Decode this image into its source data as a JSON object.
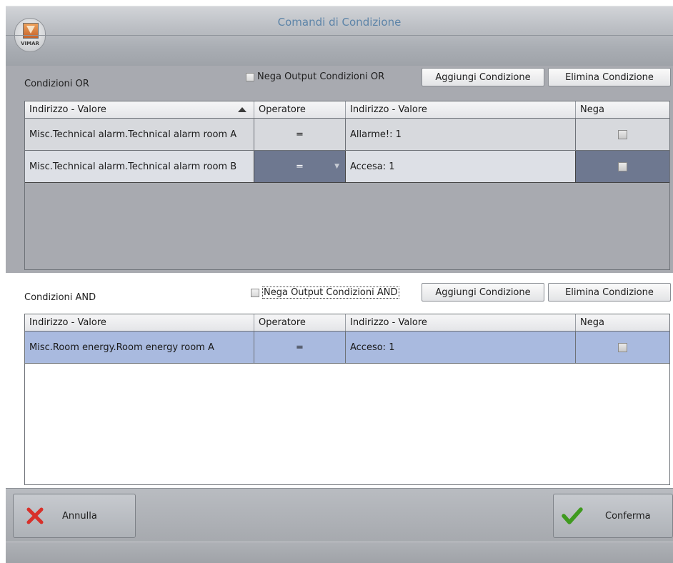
{
  "window": {
    "title": "Comandi di Condizione",
    "logo_text": "VIMAR"
  },
  "columns": {
    "address": "Indirizzo - Valore",
    "operator": "Operatore",
    "value": "Indirizzo - Valore",
    "negate": "Nega"
  },
  "or_section": {
    "label": "Condizioni OR",
    "negate_label": "Nega Output Condizioni OR",
    "add_label": "Aggiungi Condizione",
    "delete_label": "Elimina Condizione",
    "rows": [
      {
        "address": "Misc.Technical alarm.Technical alarm room A",
        "operator": "=",
        "value": "Allarme!: 1"
      },
      {
        "address": "Misc.Technical alarm.Technical alarm room B",
        "operator": "=",
        "value": "Accesa: 1"
      }
    ]
  },
  "and_section": {
    "label": "Condizioni AND",
    "negate_label": "Nega Output Condizioni AND",
    "add_label": "Aggiungi Condizione",
    "delete_label": "Elimina Condizione",
    "rows": [
      {
        "address": "Misc.Room energy.Room energy room A",
        "operator": "=",
        "value": "Acceso: 1"
      }
    ]
  },
  "footer": {
    "cancel_label": "Annulla",
    "confirm_label": "Conferma"
  },
  "colors": {
    "title": "#5d84a8",
    "selected_row": "#a9badf",
    "cancel_icon": "#d8302a",
    "confirm_icon": "#3f9a1f"
  }
}
